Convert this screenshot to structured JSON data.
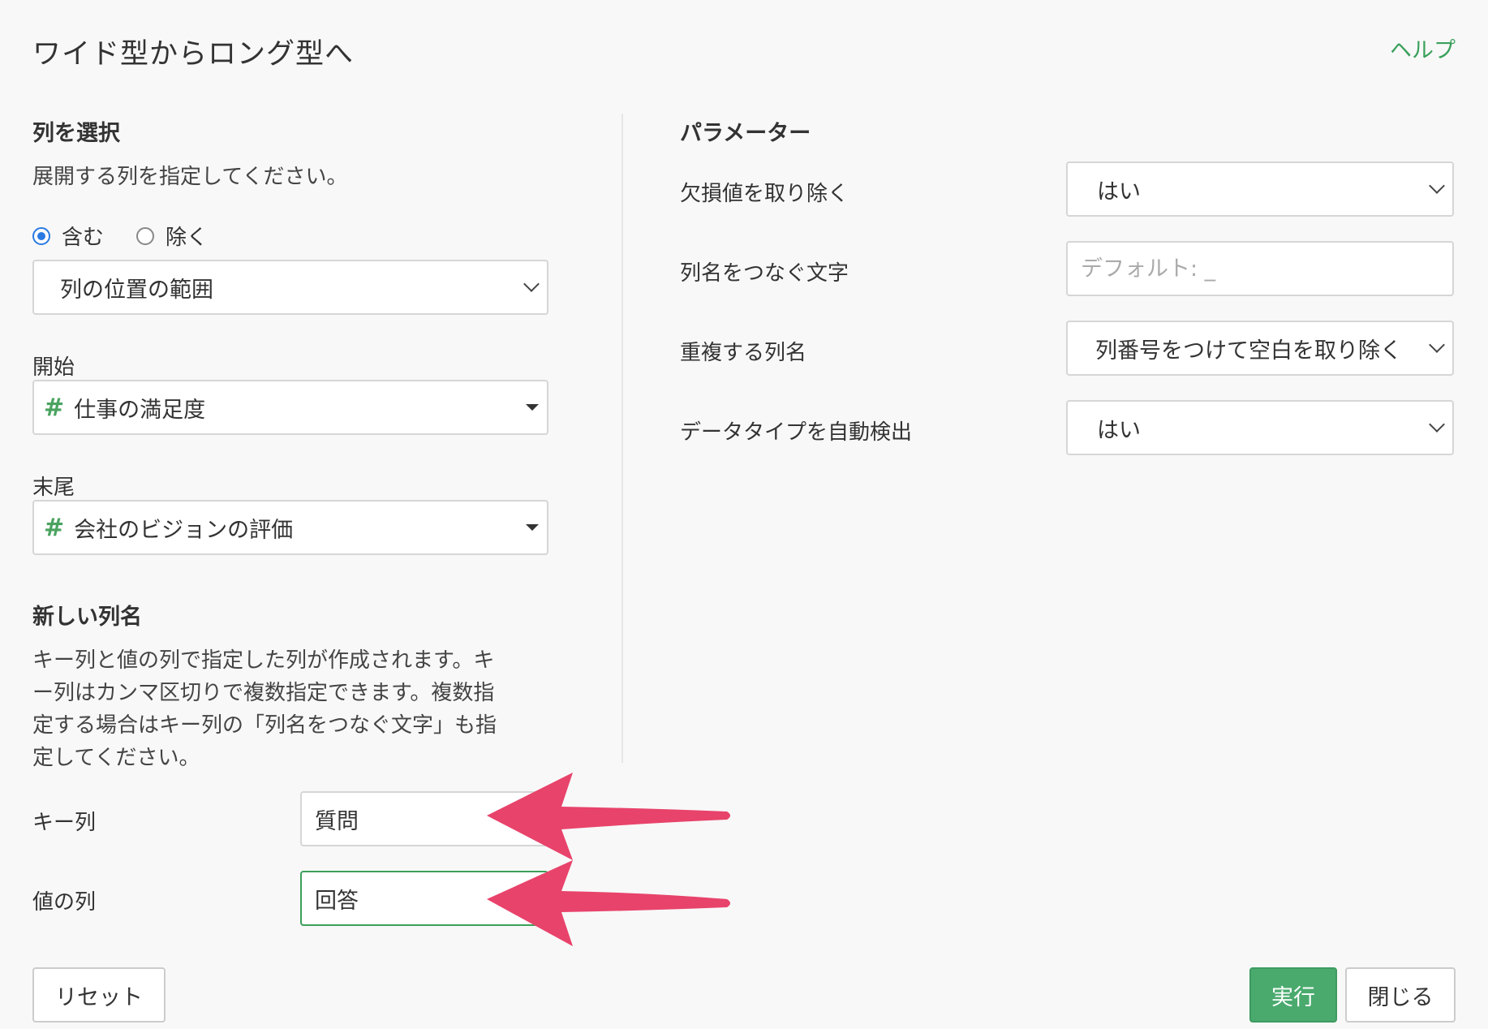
{
  "dialog": {
    "title": "ワイド型からロング型へ",
    "help_label": "ヘルプ"
  },
  "left": {
    "section_title": "列を選択",
    "description": "展開する列を指定してください。",
    "radio_include": "含む",
    "radio_exclude": "除く",
    "selected_radio": "include",
    "mode_select": "列の位置の範囲",
    "start_label": "開始",
    "start_value": "仕事の満足度",
    "end_label": "末尾",
    "end_value": "会社のビジョンの評価",
    "new_names_title": "新しい列名",
    "new_names_desc_1": "キー列と値の列で指定した列が作成されます。キ",
    "new_names_desc_2": "ー列はカンマ区切りで複数指定できます。複数指",
    "new_names_desc_3": "定する場合はキー列の「列名をつなぐ文字」も指",
    "new_names_desc_4": "定してください。",
    "key_label": "キー列",
    "key_value": "質問",
    "value_label": "値の列",
    "value_value": "回答"
  },
  "right": {
    "section_title": "パラメーター",
    "remove_na_label": "欠損値を取り除く",
    "remove_na_value": "はい",
    "sep_label": "列名をつなぐ文字",
    "sep_placeholder": "デフォルト: _",
    "dup_label": "重複する列名",
    "dup_value": "列番号をつけて空白を取り除く",
    "detect_label": "データタイプを自動検出",
    "detect_value": "はい"
  },
  "footer": {
    "reset_label": "リセット",
    "run_label": "実行",
    "close_label": "閉じる"
  },
  "colors": {
    "accent_green": "#4aaa6e",
    "radio_blue": "#2a7ae2",
    "arrow_pink": "#e8436b"
  },
  "icons": {
    "column_type": "number-hash-icon"
  }
}
